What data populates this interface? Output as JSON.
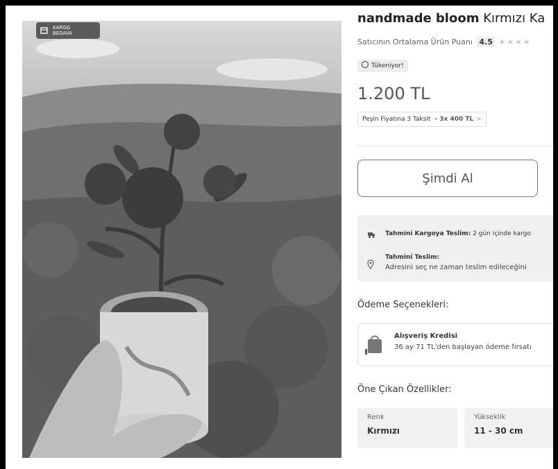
{
  "badge": {
    "line1": "KARGO",
    "line2": "BEDAVA"
  },
  "product": {
    "title_bold": "nandmade bloom",
    "title_rest": " Kırmızı Ka",
    "rating_label": "Satıcının Ortalama Ürün Puanı",
    "rating_score": "4.5",
    "stars": "★★★★",
    "stock_badge": "Tükeniyor!",
    "price": "1.200 TL",
    "installment_label": "Peşin Fiyatına 3 Taksit",
    "installment_amount": "- 3x 400 TL",
    "installment_arrow": ">"
  },
  "buy_button": "Şimdi Al",
  "delivery": {
    "row1_label": "Tahmini Kargoya Teslim:",
    "row1_value": " 2 gün içinde kargo",
    "row2_label": "Tahmini Teslim:",
    "row2_value": "Adresini seç ne zaman teslim edileceğini"
  },
  "payment": {
    "heading": "Ödeme Seçenekleri:",
    "title": "Alışveriş Kredisi",
    "desc": "36 ay 71 TL'den başlayan ödeme fırsatı"
  },
  "features": {
    "heading": "Öne Çıkan Özellikler:",
    "items": [
      {
        "label": "Renk",
        "value": "Kırmızı"
      },
      {
        "label": "Yükseklik",
        "value": "11 - 30 cm"
      }
    ]
  },
  "colors": {
    "badge_bg": "#5b5b5b",
    "panel_bg": "#f0f0f0"
  },
  "icons": [
    "cargo-box-icon",
    "clock-icon",
    "truck-icon",
    "location-pin-icon",
    "shopping-bag-icon"
  ]
}
